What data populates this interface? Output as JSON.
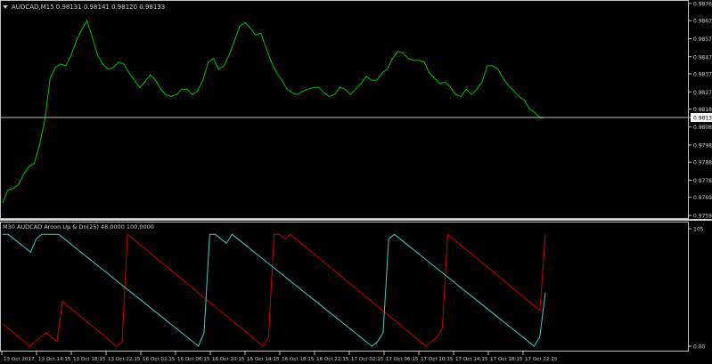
{
  "colors": {
    "background": "#000000",
    "axis": "#c0c0c0",
    "text": "#d0d0d0",
    "price_line": "#00c000",
    "current_price_bg": "#ffffff",
    "current_price_text": "#000000",
    "aroon_up": "#4fc4c4",
    "aroon_down": "#c80000",
    "separator": "#d0d0d0"
  },
  "main_panel": {
    "header": "AUDCAD,M15  0.98131 0.98141 0.98120 0.98133",
    "menu_icon": "triangle-down-icon",
    "current_price": "0.98133"
  },
  "indicator_panel": {
    "header": "M30 AUDCAD Aroon Up & Dn(25) 48.0000 100.0000"
  },
  "chart_data": [
    {
      "type": "line",
      "symbol": "AUDCAD",
      "timeframe": "M15",
      "ylim": [
        0.9759,
        0.98765
      ],
      "y_ticks": [
        "0.98765",
        "0.98670",
        "0.98570",
        "0.98470",
        "0.98375",
        "0.98275",
        "0.98180",
        "0.98133",
        "0.98080",
        "0.97980",
        "0.97885",
        "0.97785",
        "0.97690",
        "0.97590"
      ],
      "series": [
        {
          "values": [
            0.9766,
            0.9773,
            0.9774,
            0.9776,
            0.9782,
            0.9786,
            0.9788,
            0.9798,
            0.9812,
            0.9835,
            0.9841,
            0.9843,
            0.9842,
            0.9848,
            0.9856,
            0.9862,
            0.9867,
            0.9858,
            0.9848,
            0.9843,
            0.984,
            0.9841,
            0.9844,
            0.9843,
            0.9838,
            0.9834,
            0.983,
            0.9833,
            0.9837,
            0.9834,
            0.9829,
            0.9826,
            0.9825,
            0.9826,
            0.9829,
            0.9829,
            0.9826,
            0.9828,
            0.9834,
            0.9844,
            0.9846,
            0.984,
            0.9842,
            0.9848,
            0.9856,
            0.9864,
            0.9866,
            0.9863,
            0.9859,
            0.986,
            0.9852,
            0.9844,
            0.9838,
            0.9834,
            0.9829,
            0.9827,
            0.9826,
            0.9828,
            0.9829,
            0.983,
            0.983,
            0.9827,
            0.9825,
            0.9826,
            0.983,
            0.9829,
            0.9826,
            0.9829,
            0.9832,
            0.9836,
            0.9834,
            0.9834,
            0.9838,
            0.984,
            0.9846,
            0.985,
            0.9849,
            0.9846,
            0.9845,
            0.9845,
            0.9844,
            0.9838,
            0.9835,
            0.9832,
            0.9833,
            0.983,
            0.9826,
            0.9825,
            0.9829,
            0.9826,
            0.9829,
            0.9833,
            0.9842,
            0.9842,
            0.984,
            0.9835,
            0.9831,
            0.9828,
            0.9825,
            0.9823,
            0.9818,
            0.9816,
            0.9813,
            0.98133
          ]
        }
      ]
    },
    {
      "type": "line",
      "indicator": "Aroon Up & Dn(25)",
      "ylim": [
        0,
        105
      ],
      "y_ticks": [
        "105",
        "0.00"
      ],
      "series": [
        {
          "name": "Aroon Up",
          "values": [
            100,
            100,
            96,
            92,
            88,
            84,
            96,
            100,
            100,
            100,
            100,
            96,
            92,
            88,
            84,
            80,
            76,
            72,
            68,
            64,
            60,
            56,
            52,
            48,
            44,
            40,
            36,
            32,
            28,
            24,
            20,
            16,
            12,
            8,
            4,
            0,
            12,
            100,
            100,
            96,
            92,
            100,
            96,
            92,
            88,
            84,
            80,
            76,
            72,
            68,
            64,
            60,
            56,
            52,
            48,
            44,
            40,
            36,
            32,
            28,
            24,
            20,
            16,
            12,
            8,
            4,
            0,
            4,
            12,
            96,
            100,
            96,
            92,
            88,
            84,
            80,
            76,
            72,
            68,
            64,
            60,
            56,
            52,
            48,
            44,
            40,
            36,
            32,
            28,
            24,
            20,
            16,
            12,
            8,
            4,
            0,
            8,
            48
          ]
        },
        {
          "name": "Aroon Down",
          "values": [
            20,
            16,
            12,
            8,
            4,
            0,
            4,
            8,
            12,
            8,
            4,
            40,
            36,
            32,
            28,
            24,
            20,
            16,
            12,
            8,
            4,
            0,
            4,
            100,
            96,
            92,
            88,
            84,
            80,
            76,
            72,
            68,
            64,
            60,
            56,
            52,
            48,
            44,
            40,
            36,
            32,
            28,
            24,
            20,
            16,
            12,
            8,
            4,
            0,
            8,
            100,
            100,
            96,
            100,
            96,
            92,
            88,
            84,
            80,
            76,
            72,
            68,
            64,
            60,
            56,
            52,
            48,
            44,
            40,
            36,
            32,
            28,
            24,
            20,
            16,
            12,
            8,
            4,
            0,
            4,
            8,
            16,
            100,
            96,
            92,
            88,
            84,
            80,
            76,
            72,
            68,
            64,
            60,
            56,
            52,
            48,
            44,
            40,
            36,
            32,
            100
          ]
        }
      ]
    }
  ],
  "x_axis": {
    "labels": [
      "13 Oct 2017",
      "13 Oct 14:15",
      "13 Oct 18:15",
      "13 Oct 22:15",
      "16 Oct 02:15",
      "16 Oct 06:15",
      "16 Oct 10:15",
      "16 Oct 14:15",
      "16 Oct 18:15",
      "16 Oct 22:15",
      "17 Oct 02:15",
      "17 Oct 06:15",
      "17 Oct 10:15",
      "17 Oct 14:15",
      "17 Oct 18:15",
      "17 Oct 22:15"
    ]
  }
}
